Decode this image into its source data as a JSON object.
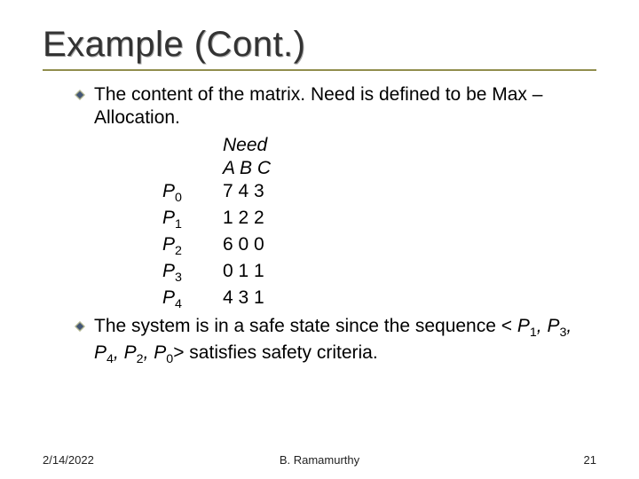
{
  "title": "Example (Cont.)",
  "bullet1": "The content of the matrix. Need is defined to be Max – Allocation.",
  "need": {
    "label": "Need",
    "columns": "A B C",
    "rows": [
      {
        "proc": "P",
        "sub": "0",
        "values": "7 4 3"
      },
      {
        "proc": "P",
        "sub": "1",
        "values": "1 2 2"
      },
      {
        "proc": "P",
        "sub": "2",
        "values": "6 0 0"
      },
      {
        "proc": "P",
        "sub": "3",
        "values": "0 1 1"
      },
      {
        "proc": "P",
        "sub": "4",
        "values": "4 3 1"
      }
    ]
  },
  "bullet2_pre": "The system is in a safe state since the sequence < ",
  "seq": [
    {
      "p": "P",
      "s": "1"
    },
    {
      "p": "P",
      "s": "3"
    },
    {
      "p": "P",
      "s": "4"
    },
    {
      "p": "P",
      "s": "2"
    },
    {
      "p": "P",
      "s": "0"
    }
  ],
  "bullet2_post": "> satisfies safety criteria.",
  "footer": {
    "date": "2/14/2022",
    "author": "B. Ramamurthy",
    "page": "21"
  }
}
